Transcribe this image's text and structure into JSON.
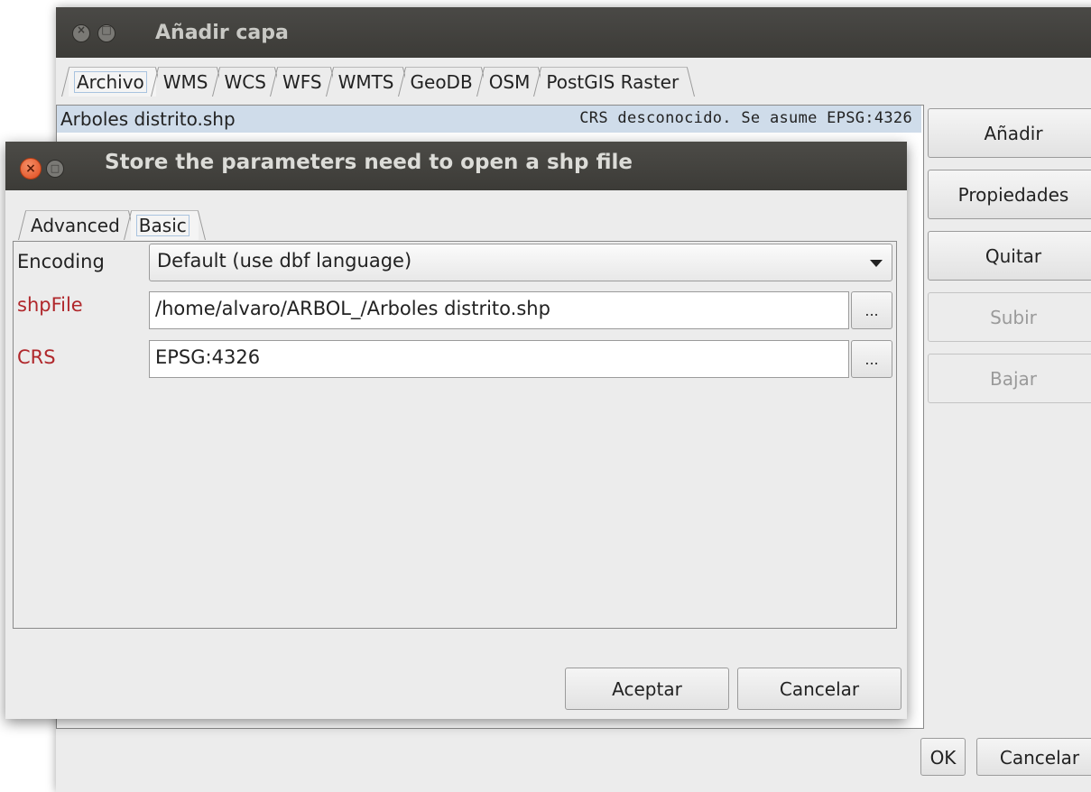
{
  "back_window": {
    "title": "Añadir capa",
    "tabs": [
      {
        "label": "Archivo",
        "active": true
      },
      {
        "label": "WMS",
        "active": false
      },
      {
        "label": "WCS",
        "active": false
      },
      {
        "label": "WFS",
        "active": false
      },
      {
        "label": "WMTS",
        "active": false
      },
      {
        "label": "GeoDB",
        "active": false
      },
      {
        "label": "OSM",
        "active": false
      },
      {
        "label": "PostGIS Raster",
        "active": false
      }
    ],
    "file_list": [
      {
        "name": "Arboles distrito.shp",
        "crs_note": "CRS desconocido. Se asume EPSG:4326",
        "selected": true
      }
    ],
    "side_buttons": {
      "add": "Añadir",
      "properties": "Propiedades",
      "remove": "Quitar",
      "up": "Subir",
      "down": "Bajar"
    },
    "footer_buttons": {
      "ok": "OK",
      "cancel": "Cancelar"
    }
  },
  "dialog": {
    "title": "Store the parameters need to open a shp file",
    "tabs": [
      {
        "label": "Advanced",
        "active": false
      },
      {
        "label": "Basic",
        "active": true
      }
    ],
    "fields": {
      "encoding": {
        "label": "Encoding",
        "value": "Default (use dbf language)"
      },
      "shpfile": {
        "label": "shpFile",
        "value": "/home/alvaro/ARBOL_/Arboles distrito.shp",
        "browse": "..."
      },
      "crs": {
        "label": "CRS",
        "value": "EPSG:4326",
        "browse": "..."
      }
    },
    "buttons": {
      "accept": "Aceptar",
      "cancel": "Cancelar"
    }
  },
  "colors": {
    "titlebar": "#3c3b37",
    "required_label": "#b0272b",
    "selection": "#cfdcea",
    "close_button": "#df4a1d"
  }
}
